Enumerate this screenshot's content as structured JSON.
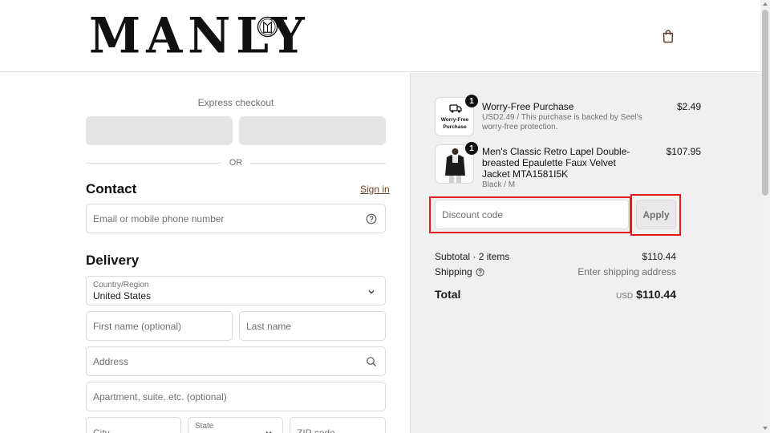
{
  "header": {
    "logo_text": "MANLY",
    "cart_icon": "shopping-bag-icon"
  },
  "express": {
    "label": "Express checkout",
    "or_label": "OR"
  },
  "contact": {
    "title": "Contact",
    "sign_in": "Sign in",
    "email_placeholder": "Email or mobile phone number",
    "help_icon": "help-circle-icon"
  },
  "delivery": {
    "title": "Delivery",
    "country_label": "Country/Region",
    "country_value": "United States",
    "first_name_placeholder": "First name (optional)",
    "last_name_placeholder": "Last name",
    "address_placeholder": "Address",
    "apartment_placeholder": "Apartment, suite, etc. (optional)",
    "city_placeholder": "City",
    "state_label": "State",
    "zip_placeholder": "ZIP code"
  },
  "summary": {
    "items": [
      {
        "quantity": "1",
        "name": "Worry-Free Purchase",
        "subtitle": "USD2.49 / This purchase is backed by Seel's worry-free protection.",
        "price": "$2.49",
        "thumb_text": "Worry-Free Purchase"
      },
      {
        "quantity": "1",
        "name": "Men's Classic Retro Lapel Double-breasted Epaulette Faux Velvet Jacket MTA1581I5K",
        "subtitle": "Black / M",
        "price": "$107.95"
      }
    ],
    "discount_placeholder": "Discount code",
    "apply_label": "Apply",
    "subtotal_label": "Subtotal · 2 items",
    "subtotal_value": "$110.44",
    "shipping_label": "Shipping",
    "shipping_value": "Enter shipping address",
    "total_label": "Total",
    "total_currency": "USD",
    "total_value": "$110.44"
  },
  "colors": {
    "accent_link": "#6b3f1d",
    "highlight_red": "#e01b1b",
    "summary_bg": "#f0f0f0"
  }
}
